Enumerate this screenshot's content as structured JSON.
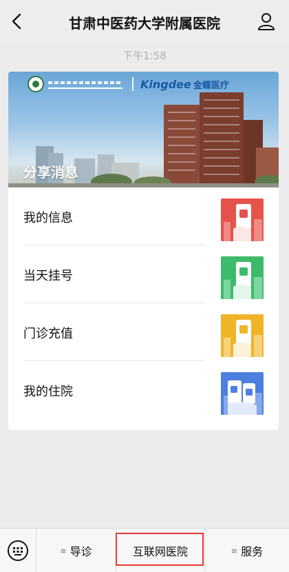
{
  "nav": {
    "title": "甘肃中医药大学附属医院",
    "back_icon": "chevron-left-icon",
    "profile_icon": "person-icon"
  },
  "timestamp": "下午1:58",
  "card": {
    "banner": {
      "logo_brand": "Kingdee",
      "logo_brand_cn": "金蝶医疗",
      "title": "分享消息"
    },
    "items": [
      {
        "label": "我的信息",
        "thumb_color": "#e5534b"
      },
      {
        "label": "当天挂号",
        "thumb_color": "#3dbb6b"
      },
      {
        "label": "门诊充值",
        "thumb_color": "#f0b429"
      },
      {
        "label": "我的住院",
        "thumb_color": "#4d7fe0"
      }
    ]
  },
  "tabbar": {
    "keyboard_icon": "keyboard-icon",
    "tabs": [
      {
        "label": "导诊"
      },
      {
        "label": "互联网医院"
      },
      {
        "label": "服务"
      }
    ],
    "highlight_color": "#e53935"
  }
}
